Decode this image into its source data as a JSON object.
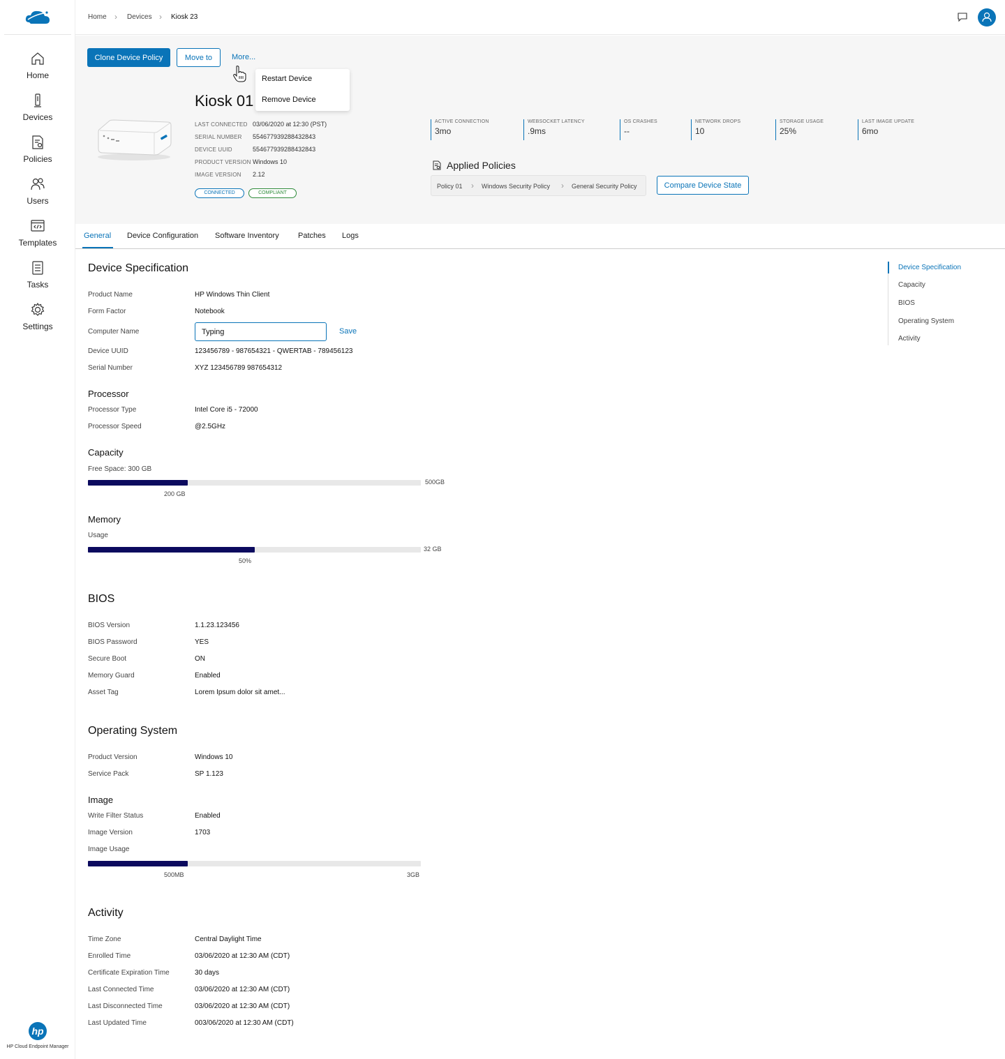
{
  "colors": {
    "accent": "#0a74b8",
    "bar_fill": "#0c0a5e",
    "compliant": "#2e8b3a"
  },
  "sidebar": {
    "items": [
      {
        "label": "Home",
        "icon": "home-icon"
      },
      {
        "label": "Devices",
        "icon": "device-icon"
      },
      {
        "label": "Policies",
        "icon": "policy-icon"
      },
      {
        "label": "Users",
        "icon": "users-icon"
      },
      {
        "label": "Templates",
        "icon": "template-icon"
      },
      {
        "label": "Tasks",
        "icon": "tasks-icon"
      },
      {
        "label": "Settings",
        "icon": "gear-icon"
      }
    ],
    "brand_name": "HP Cloud Endpoint Manager",
    "brand_logo": "hp"
  },
  "breadcrumb": {
    "items": [
      "Home",
      "Devices",
      "Kiosk 23"
    ]
  },
  "actions": {
    "clone": "Clone Device Policy",
    "move": "Move to",
    "more": "More...",
    "menu": [
      "Restart Device",
      "Remove Device"
    ]
  },
  "device": {
    "title": "Kiosk 01",
    "meta": [
      {
        "label": "LAST CONNECTED",
        "value": "03/06/2020 at 12:30 (PST)"
      },
      {
        "label": "SERIAL NUMBER",
        "value": "554677939288432843"
      },
      {
        "label": "DEVICE UUID",
        "value": "554677939288432843"
      },
      {
        "label": "PRODUCT VERSION",
        "value": "Windows 10"
      },
      {
        "label": "IMAGE VERSION",
        "value": "2.12"
      }
    ],
    "badges": [
      "CONNECTED",
      "COMPLIANT"
    ]
  },
  "stats": [
    {
      "label": "ACTIVE CONNECTION",
      "value": "3mo"
    },
    {
      "label": "WEBSOCKET LATENCY",
      "value": ".9ms"
    },
    {
      "label": "OS CRASHES",
      "value": "--"
    },
    {
      "label": "NETWORK DROPS",
      "value": "10"
    },
    {
      "label": "STORAGE USAGE",
      "value": "25%"
    },
    {
      "label": "LAST IMAGE UPDATE",
      "value": "6mo"
    }
  ],
  "policies": {
    "title": "Applied Policies",
    "chain": [
      "Policy 01",
      "Windows Security Policy",
      "General Security Policy"
    ],
    "compare": "Compare Device State"
  },
  "tabs": [
    "General",
    "Device Configuration",
    "Software Inventory",
    "Patches",
    "Logs"
  ],
  "spec": {
    "title": "Device Specification",
    "rows": [
      {
        "label": "Product Name",
        "value": "HP Windows Thin Client"
      },
      {
        "label": "Form Factor",
        "value": "Notebook"
      },
      {
        "label": "Computer Name",
        "value": "Typing"
      },
      {
        "label": "Device UUID",
        "value": "123456789 - 987654321 - QWERTAB - 789456123"
      },
      {
        "label": "Serial Number",
        "value": "XYZ 123456789 987654312"
      }
    ],
    "save": "Save"
  },
  "processor": {
    "title": "Processor",
    "rows": [
      {
        "label": "Processor Type",
        "value": "Intel Core i5 - 72000"
      },
      {
        "label": "Processor Speed",
        "value": "@2.5GHz"
      }
    ]
  },
  "capacity": {
    "title": "Capacity",
    "label": "Free Space: 300 GB",
    "used": "200 GB",
    "max": "500GB",
    "fraction": 0.3
  },
  "memory": {
    "title": "Memory",
    "label": "Usage",
    "used": "50%",
    "max": "32 GB",
    "fraction": 0.5
  },
  "bios": {
    "title": "BIOS",
    "rows": [
      {
        "label": "BIOS Version",
        "value": "1.1.23.123456"
      },
      {
        "label": "BIOS Password",
        "value": "YES"
      },
      {
        "label": "Secure Boot",
        "value": "ON"
      },
      {
        "label": "Memory Guard",
        "value": "Enabled"
      },
      {
        "label": "Asset Tag",
        "value": "Lorem Ipsum dolor sit amet..."
      }
    ]
  },
  "os": {
    "title": "Operating System",
    "rows": [
      {
        "label": "Product Version",
        "value": "Windows 10"
      },
      {
        "label": "Service Pack",
        "value": "SP 1.123"
      }
    ]
  },
  "image": {
    "title": "Image",
    "rows": [
      {
        "label": "Write Filter Status",
        "value": "Enabled"
      },
      {
        "label": "Image Version",
        "value": "1703"
      },
      {
        "label": "Image Usage",
        "value": ""
      }
    ],
    "used": "500MB",
    "max": "3GB",
    "fraction": 0.3
  },
  "activity": {
    "title": "Activity",
    "rows": [
      {
        "label": "Time Zone",
        "value": "Central Daylight Time"
      },
      {
        "label": "Enrolled Time",
        "value": "03/06/2020 at 12:30 AM (CDT)"
      },
      {
        "label": "Certificate Expiration Time",
        "value": "30 days"
      },
      {
        "label": "Last Connected Time",
        "value": "03/06/2020 at 12:30 AM (CDT)"
      },
      {
        "label": "Last Disconnected Time",
        "value": "03/06/2020 at 12:30 AM (CDT)"
      },
      {
        "label": "Last Updated Time",
        "value": "003/06/2020 at 12:30 AM (CDT)"
      }
    ]
  },
  "right_nav": [
    "Device Specification",
    "Capacity",
    "BIOS",
    "Operating System",
    "Activity"
  ]
}
